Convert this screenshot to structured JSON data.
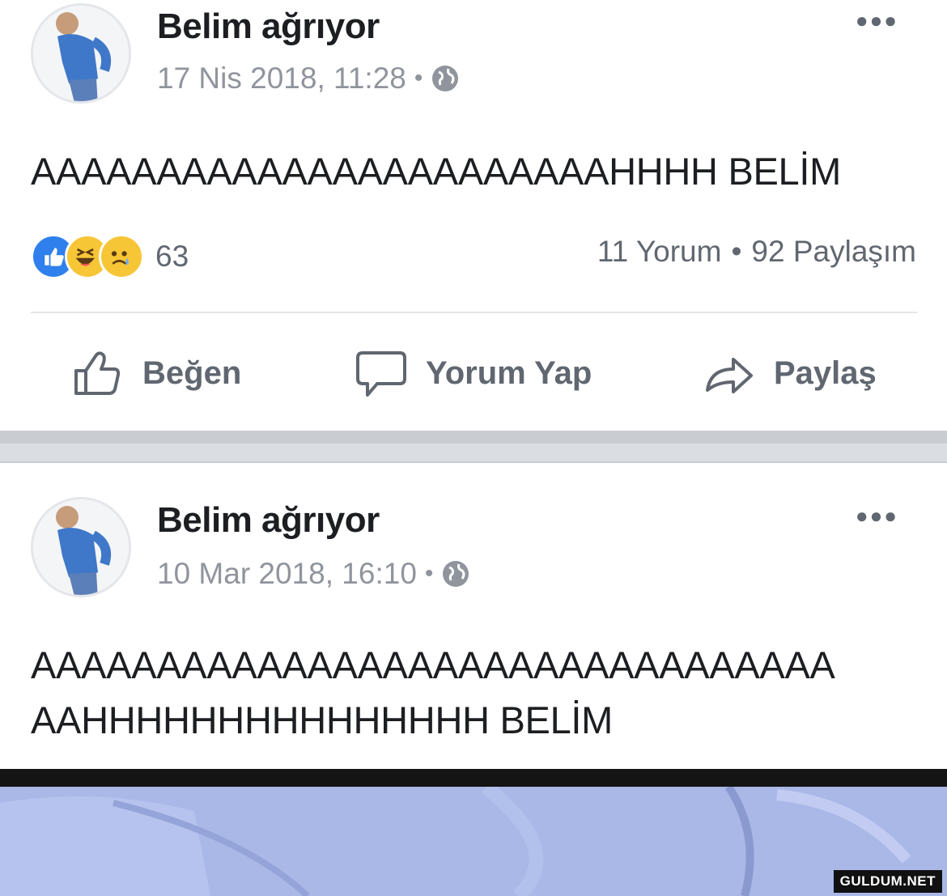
{
  "posts": [
    {
      "author": "Belim ağrıyor",
      "timestamp": "17 Nis 2018, 11:28",
      "visibility_icon": "globe-icon",
      "text": "AAAAAAAAAAAAAAAAAAAAAAAHHHH BELİM",
      "reaction_count": "63",
      "reactions": [
        "like",
        "haha",
        "sad"
      ],
      "comments": "11 Yorum",
      "shares": "92 Paylaşım",
      "actions": {
        "like": "Beğen",
        "comment": "Yorum Yap",
        "share": "Paylaş"
      }
    },
    {
      "author": "Belim ağrıyor",
      "timestamp": "10 Mar 2018, 16:10",
      "visibility_icon": "globe-icon",
      "text_line1": "AAAAAAAAAAAAAAAAAAAAAAAAAAAAAAAA",
      "text_line2": "AAHHHHHHHHHHHHHHH BELİM"
    }
  ],
  "watermark": "GULDUM.NET",
  "colors": {
    "secondary_text": "#606770",
    "meta_text": "#90949c",
    "like_blue": "#2f80ed",
    "separator": "#c9ccd1"
  }
}
